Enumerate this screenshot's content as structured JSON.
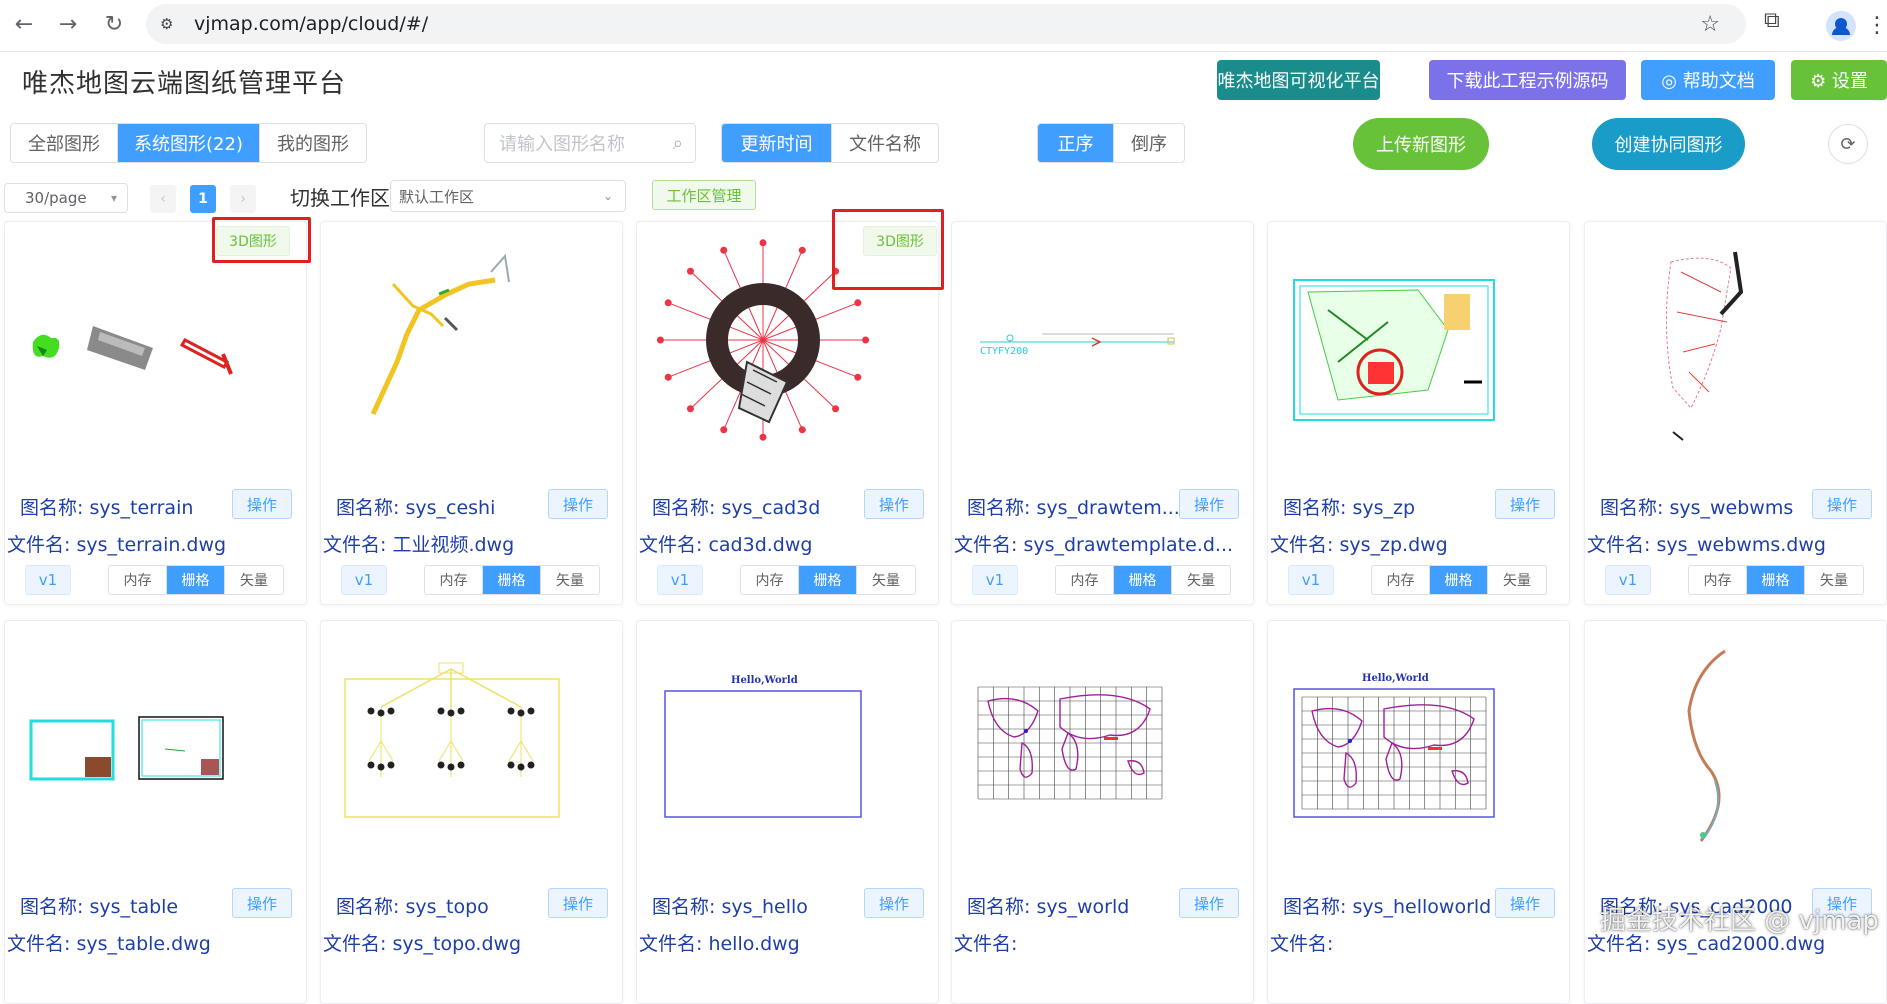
{
  "browser": {
    "url": "vjmap.com/app/cloud/#/"
  },
  "app": {
    "title": "唯杰地图云端图纸管理平台"
  },
  "header_buttons": [
    {
      "label": "唯杰地图可视化平台",
      "color": "#1a8c8c"
    },
    {
      "label": "下载此工程示例源码",
      "color": "#7b72e9"
    },
    {
      "label": "◎ 帮助文档",
      "color": "#409eff"
    },
    {
      "label": "⚙ 设置",
      "color": "#67c23a"
    }
  ],
  "filter_tabs": [
    "全部图形",
    "系统图形(22)",
    "我的图形"
  ],
  "filter_active": 1,
  "search": {
    "placeholder": "请输入图形名称"
  },
  "sort_by": [
    "更新时间",
    "文件名称"
  ],
  "sort_order": [
    "正序",
    "倒序"
  ],
  "actions": {
    "upload": "上传新图形",
    "create": "创建协同图形"
  },
  "pagination": {
    "page_size": "30/page",
    "prev": "‹",
    "current": "1",
    "next": "›"
  },
  "workspace": {
    "label": "切换工作区",
    "selected": "默认工作区",
    "manage": "工作区管理"
  },
  "card_labels": {
    "map_prefix": "图名称: ",
    "file_prefix": "文件名: ",
    "op": "操作",
    "version": "v1",
    "modes": [
      "内存",
      "栅格",
      "矢量"
    ],
    "active_mode": 1
  },
  "tag_3d": "3D图形",
  "cards": [
    {
      "map": "sys_terrain",
      "file": "sys_terrain.dwg",
      "tag3d": true
    },
    {
      "map": "sys_ceshi",
      "file": "工业视频.dwg",
      "tag3d": false
    },
    {
      "map": "sys_cad3d",
      "file": "cad3d.dwg",
      "tag3d": true
    },
    {
      "map": "sys_drawtem...",
      "file": "sys_drawtemplate.d...",
      "tag3d": false
    },
    {
      "map": "sys_zp",
      "file": "sys_zp.dwg",
      "tag3d": false
    },
    {
      "map": "sys_webwms",
      "file": "sys_webwms.dwg",
      "tag3d": false
    },
    {
      "map": "sys_table",
      "file": "sys_table.dwg",
      "tag3d": false
    },
    {
      "map": "sys_topo",
      "file": "sys_topo.dwg",
      "tag3d": false
    },
    {
      "map": "sys_hello",
      "file": "hello.dwg",
      "tag3d": false
    },
    {
      "map": "sys_world",
      "file": "",
      "tag3d": false
    },
    {
      "map": "sys_helloworld",
      "file": "",
      "tag3d": false
    },
    {
      "map": "sys_cad2000",
      "file": "sys_cad2000.dwg",
      "tag3d": false
    }
  ],
  "thumb_text": {
    "drawtemplate": "CTYFY200",
    "hello": "Hello,World"
  },
  "watermark": "掘金技术社区 @ vjmap"
}
